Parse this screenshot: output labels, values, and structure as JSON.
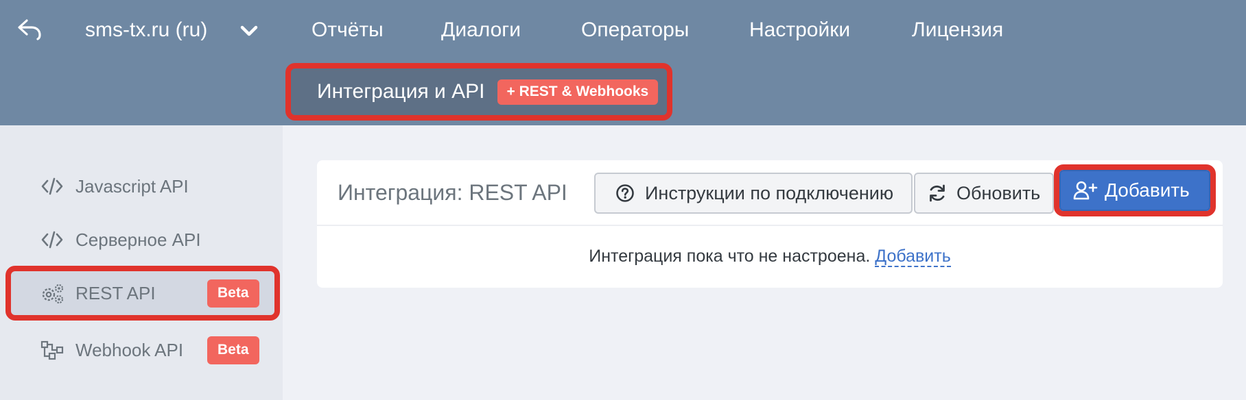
{
  "topbar": {
    "project": "sms-tx.ru (ru)",
    "nav": [
      "Отчёты",
      "Диалоги",
      "Операторы",
      "Настройки",
      "Лицензия"
    ],
    "subnav": {
      "label": "Интеграция и API",
      "badge": "+ REST & Webhooks"
    }
  },
  "sidebar": {
    "items": [
      {
        "label": "Javascript API",
        "icon": "code-icon"
      },
      {
        "label": "Серверное API",
        "icon": "code-icon"
      },
      {
        "label": "REST API",
        "icon": "cogs-icon",
        "badge": "Beta",
        "active": true
      },
      {
        "label": "Webhook API",
        "icon": "sitemap-icon",
        "badge": "Beta"
      }
    ]
  },
  "main": {
    "title": "Интеграция: REST API",
    "buttons": {
      "instructions": "Инструкции по подключению",
      "refresh": "Обновить",
      "add": "Добавить"
    },
    "empty": {
      "text": "Интеграция пока что не настроена.",
      "link": "Добавить"
    }
  },
  "colors": {
    "topbar": "#6f88a3",
    "subnav_active": "#5e7086",
    "badge": "#f2665e",
    "highlight": "#e0332c",
    "primary": "#3d72c9"
  }
}
